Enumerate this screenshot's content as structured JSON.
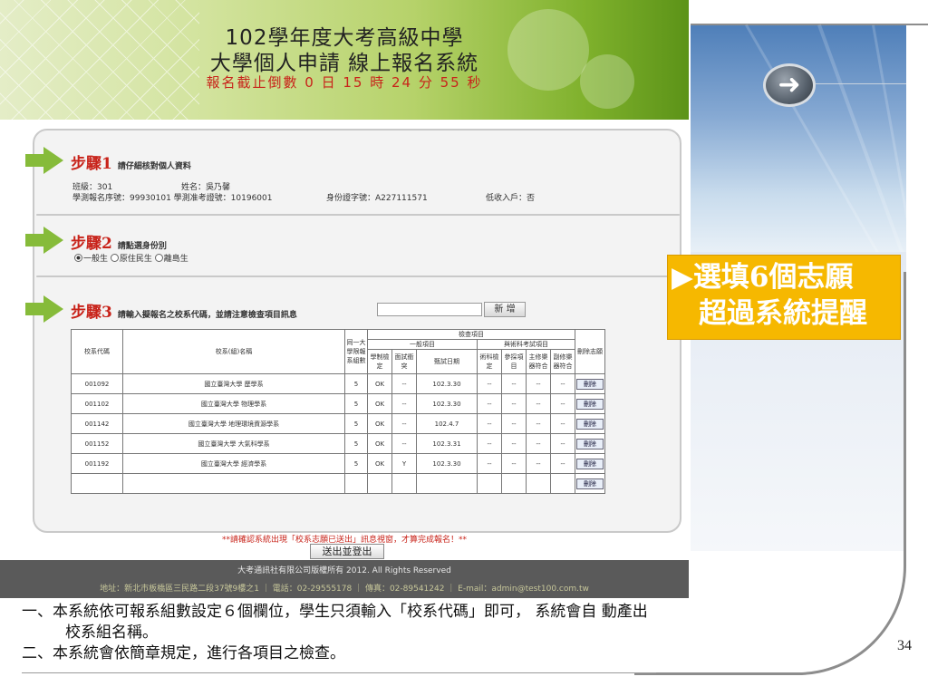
{
  "banner": {
    "title_line1": "102學年度大考高級中學",
    "title_line2": "大學個人申請  線上報名系統",
    "countdown": "報名截止倒數 0 日 15 時 24 分 55 秒"
  },
  "step1": {
    "title": "步驟1",
    "desc": "請仔細核對個人資料",
    "class_label": "班級：301",
    "name_label": "姓名：吳乃馨",
    "exam_seq": "學測報名序號：99930101 學測准考證號：10196001",
    "id_no": "身份證字號：A227111571",
    "low_income": "低收入戶：否"
  },
  "step2": {
    "title": "步驟2",
    "desc": "請點選身份別",
    "options": [
      "一般生",
      "原住民生",
      "離島生"
    ],
    "selected": "一般生"
  },
  "step3": {
    "title": "步驟3",
    "desc": "請輸入擬報名之校系代碼，並請注意檢查項目訊息",
    "add_button": "新 增",
    "headers": {
      "code": "校系代碼",
      "name": "校系(組)名稱",
      "same_univ": "同一大學限報系組數",
      "check_items": "檢查項目",
      "general": "一般項目",
      "special": "與術科考試項目",
      "edu_check": "學制檢定",
      "time_conflict": "面試衝突",
      "exam_date": "甄試日期",
      "subject_check": "術科檢定",
      "reference": "參採項目",
      "main_minor": "主修樂器符合",
      "other_check": "副修樂器符合",
      "delete": "刪除志願"
    },
    "rows": [
      {
        "code": "001092",
        "name": "國立臺灣大學  歷學系",
        "limit": "5",
        "edu": "OK",
        "conflict": "--",
        "date": "102.3.30",
        "s1": "--",
        "s2": "--",
        "s3": "--",
        "s4": "--",
        "del": "刪除"
      },
      {
        "code": "001102",
        "name": "國立臺灣大學  物理學系",
        "limit": "5",
        "edu": "OK",
        "conflict": "--",
        "date": "102.3.30",
        "s1": "--",
        "s2": "--",
        "s3": "--",
        "s4": "--",
        "del": "刪除"
      },
      {
        "code": "001142",
        "name": "國立臺灣大學  地理環境資源學系",
        "limit": "5",
        "edu": "OK",
        "conflict": "--",
        "date": "102.4.7",
        "s1": "--",
        "s2": "--",
        "s3": "--",
        "s4": "--",
        "del": "刪除"
      },
      {
        "code": "001152",
        "name": "國立臺灣大學  大氣科學系",
        "limit": "5",
        "edu": "OK",
        "conflict": "--",
        "date": "102.3.31",
        "s1": "--",
        "s2": "--",
        "s3": "--",
        "s4": "--",
        "del": "刪除"
      },
      {
        "code": "001192",
        "name": "國立臺灣大學  經濟學系",
        "limit": "5",
        "edu": "OK",
        "conflict": "Y",
        "date": "102.3.30",
        "s1": "--",
        "s2": "--",
        "s3": "--",
        "s4": "--",
        "del": "刪除"
      },
      {
        "code": "",
        "name": "",
        "limit": "",
        "edu": "",
        "conflict": "",
        "date": "",
        "s1": "",
        "s2": "",
        "s3": "",
        "s4": "",
        "del": "刪除"
      }
    ]
  },
  "warning": "**請確認系統出現「校系志願已送出」訊息視窗，才算完成報名！**",
  "logout_button": "送出並登出",
  "footer": {
    "copyright": "大考通訊社有限公司版權所有 2012. All Rights Reserved",
    "contact": "地址：新北市板橋區三民路二段37號9樓之1 ｜ 電話：02-29555178 ｜ 傳真：02-89541242 ｜ E-mail：admin@test100.com.tw"
  },
  "callout": {
    "line1": "▶選填6個志願",
    "line2": "超過系統提醒"
  },
  "notes": {
    "line1": "一、本系統依可報系組數設定６個欄位，學生只須輸入「校系代碼」即可， 系統會自 動產出",
    "line2": "校系組名稱。",
    "line3": "二、本系統會依簡章規定，進行各項目之檢查。"
  },
  "page_number": "34",
  "colors": {
    "accent_red": "#c8231a",
    "arrow_green": "#86bb3a",
    "callout_yellow": "#f6b800"
  },
  "icons": {
    "nav_arrow": "right-arrow-circle-icon",
    "step_arrow": "green-right-arrow-icon"
  }
}
